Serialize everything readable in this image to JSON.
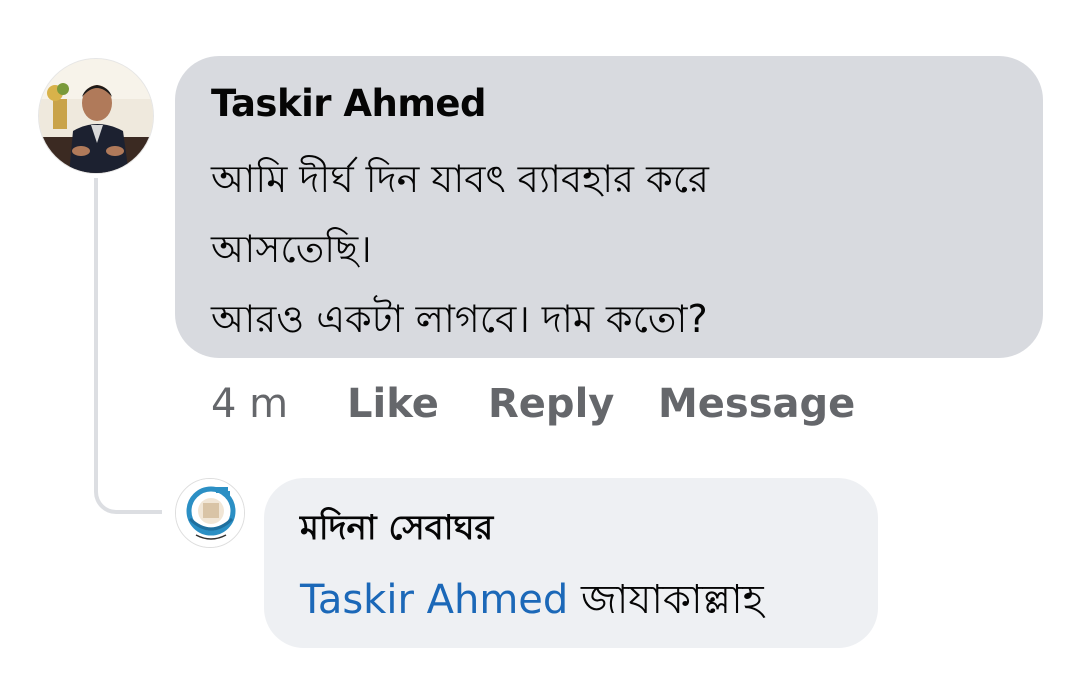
{
  "comment": {
    "author": "Taskir Ahmed",
    "lines": [
      "আমি দীর্ঘ দিন যাবৎ ব্যাবহার করে",
      "আসতেছি।",
      "আরও একটা লাগবে। দাম কতো?"
    ],
    "bubble_color": "#d8dadf"
  },
  "actions": {
    "time": "4 m",
    "like": "Like",
    "reply": "Reply",
    "message": "Message",
    "color": "#65676b"
  },
  "reply": {
    "author": "মদিনা সেবাঘর",
    "mention": "Taskir Ahmed",
    "text": "জাযাকাল্লাহ",
    "mention_color": "#1b68b8",
    "bubble_color": "#eef0f3"
  },
  "icons": {
    "main_avatar": "user-avatar-photo",
    "reply_avatar": "page-logo-avatar"
  }
}
